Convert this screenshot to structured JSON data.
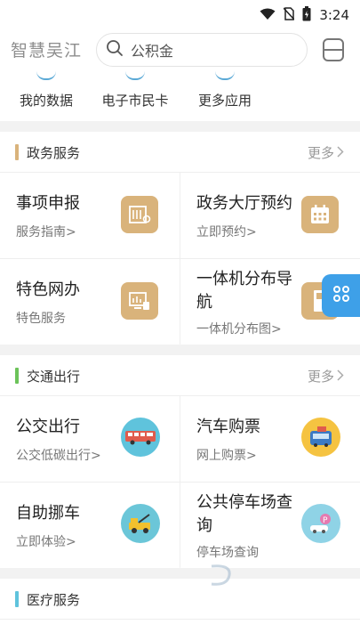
{
  "status_bar": {
    "time": "3:24",
    "icons": [
      "wifi-icon",
      "no-sim-icon",
      "battery-icon"
    ]
  },
  "header": {
    "app_title": "智慧吴江",
    "search_placeholder": "公积金"
  },
  "quick_links": [
    {
      "label": "我的数据"
    },
    {
      "label": "电子市民卡"
    },
    {
      "label": "更多应用"
    }
  ],
  "sections": {
    "gov": {
      "title": "政务服务",
      "more": "更多",
      "accent": "#d9b37b",
      "items": [
        {
          "name": "事项申报",
          "sub": "服务指南>",
          "icon": "form-icon"
        },
        {
          "name": "政务大厅预约",
          "sub": "立即预约>",
          "icon": "calendar-icon"
        },
        {
          "name": "特色网办",
          "sub": "特色服务",
          "icon": "monitor-icon"
        },
        {
          "name": "一体机分布导航",
          "sub": "一体机分布图>",
          "icon": "kiosk-icon"
        }
      ]
    },
    "traffic": {
      "title": "交通出行",
      "more": "更多",
      "accent": "#6cc35a",
      "items": [
        {
          "name": "公交出行",
          "sub": "公交低碳出行>",
          "icon": "bus-icon"
        },
        {
          "name": "汽车购票",
          "sub": "网上购票>",
          "icon": "coach-icon"
        },
        {
          "name": "自助挪车",
          "sub": "立即体验>",
          "icon": "tow-truck-icon"
        },
        {
          "name": "公共停车场查询",
          "sub": "停车场查询",
          "icon": "parking-icon"
        }
      ]
    },
    "medical": {
      "title": "医疗服务",
      "accent": "#5fc3dc"
    }
  }
}
